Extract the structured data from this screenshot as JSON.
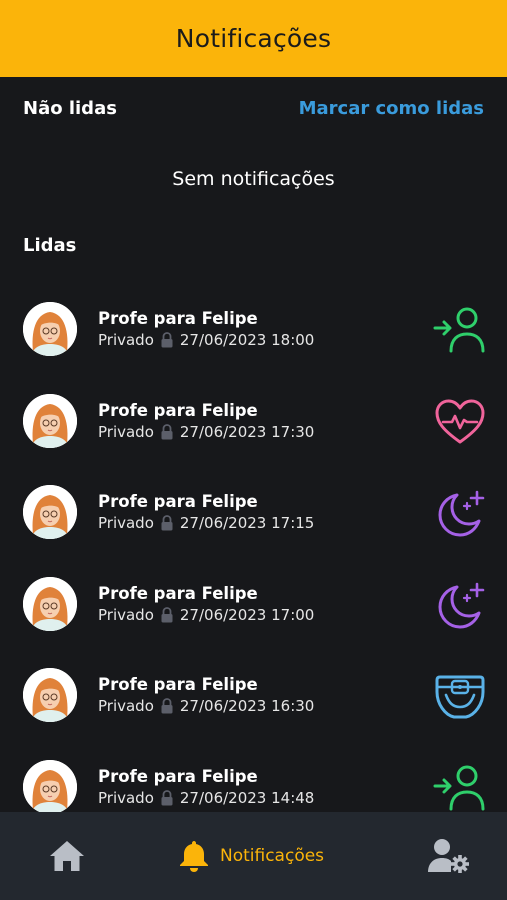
{
  "header": {
    "title": "Notificações"
  },
  "unread": {
    "title": "Não lidas",
    "mark_all_label": "Marcar como lidas",
    "empty_text": "Sem notificações"
  },
  "read": {
    "title": "Lidas",
    "items": [
      {
        "title": "Profe para Felipe",
        "visibility": "Privado",
        "datetime": "27/06/2023 18:00",
        "icon": "user-arrow-icon",
        "icon_color": "#2fcf6b"
      },
      {
        "title": "Profe para Felipe",
        "visibility": "Privado",
        "datetime": "27/06/2023 17:30",
        "icon": "heart-pulse-icon",
        "icon_color": "#f0649b"
      },
      {
        "title": "Profe para Felipe",
        "visibility": "Privado",
        "datetime": "27/06/2023 17:15",
        "icon": "moon-stars-icon",
        "icon_color": "#a561e6"
      },
      {
        "title": "Profe para Felipe",
        "visibility": "Privado",
        "datetime": "27/06/2023 17:00",
        "icon": "moon-stars-icon",
        "icon_color": "#a561e6"
      },
      {
        "title": "Profe para Felipe",
        "visibility": "Privado",
        "datetime": "27/06/2023 16:30",
        "icon": "diaper-icon",
        "icon_color": "#5ab2e8"
      },
      {
        "title": "Profe para Felipe",
        "visibility": "Privado",
        "datetime": "27/06/2023 14:48",
        "icon": "user-arrow-icon",
        "icon_color": "#2fcf6b"
      }
    ]
  },
  "bottom_nav": {
    "home_icon": "home-icon",
    "notifications_label": "Notificações",
    "notifications_icon": "bell-icon",
    "profile_icon": "user-settings-icon",
    "active_color": "#fbb40a",
    "inactive_color": "#b9bec6"
  }
}
